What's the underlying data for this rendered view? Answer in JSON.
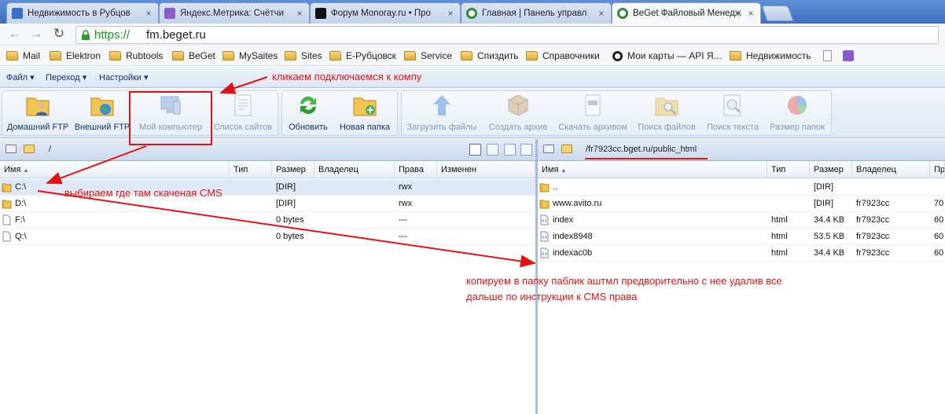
{
  "browser": {
    "tabs": [
      {
        "title": "Недвижимость в Рубцов",
        "icon": "house-favicon",
        "color": "#3b6fc6"
      },
      {
        "title": "Яндекс.Метрика: Счётчи",
        "icon": "metrika-favicon",
        "color": "#8a5cc9"
      },
      {
        "title": "Форум Monoray.ru • Про",
        "icon": "monoray-favicon",
        "color": "#111111"
      },
      {
        "title": "Главная | Панель управл",
        "icon": "beget-favicon",
        "color": "#2e8b2e"
      },
      {
        "title": "BeGet Файловый Менедж",
        "icon": "beget-favicon",
        "color": "#2e8b2e",
        "active": true
      }
    ],
    "url_scheme": "https://",
    "url_host": "fm.beget.ru",
    "bookmarks": [
      "Mail",
      "Elektron",
      "Rubtools",
      "BeGet",
      "MySaites",
      "Sites",
      "Е-Рубцовск",
      "Service",
      "Спиздить",
      "Справочники",
      "Мои карты — API Я...",
      "Недвижимость"
    ]
  },
  "menubar": {
    "file": "Файл",
    "goto": "Переход",
    "settings": "Настройки"
  },
  "ribbon": {
    "home_ftp": "Домашний FTP",
    "external_ftp": "Внешний FTP",
    "my_computer": "Мой компьютер",
    "site_list": "Список сайтов",
    "refresh": "Обновить",
    "new_folder": "Новая папка",
    "upload": "Загрузить файлы",
    "create_archive": "Создать архив",
    "download_archive": "Скачать архивом",
    "file_search": "Поиск файлов",
    "text_search": "Поиск текста",
    "folder_size": "Размер папок"
  },
  "left_pane": {
    "path": "/",
    "columns": [
      "Имя",
      "Тип",
      "Размер",
      "Владелец",
      "Права",
      "Изменен"
    ],
    "rows": [
      {
        "name": "C:\\",
        "type": "",
        "size": "[DIR]",
        "owner": "",
        "perms": "rwx",
        "icon": "folder"
      },
      {
        "name": "D:\\",
        "type": "",
        "size": "[DIR]",
        "owner": "",
        "perms": "rwx",
        "icon": "folder"
      },
      {
        "name": "F:\\",
        "type": "",
        "size": "0 bytes",
        "owner": "",
        "perms": "---",
        "icon": "file"
      },
      {
        "name": "Q:\\",
        "type": "",
        "size": "0 bytes",
        "owner": "",
        "perms": "---",
        "icon": "file"
      }
    ]
  },
  "right_pane": {
    "path": "/fr7923cc.bget.ru/public_html",
    "columns": [
      "Имя",
      "Тип",
      "Размер",
      "Владелец",
      "Пр"
    ],
    "rows": [
      {
        "name": "..",
        "type": "",
        "size": "[DIR]",
        "owner": "",
        "perms": "",
        "icon": "folder"
      },
      {
        "name": "www.avito.ru",
        "type": "",
        "size": "[DIR]",
        "owner": "fr7923cc",
        "perms": "70",
        "icon": "folder"
      },
      {
        "name": "index",
        "type": "html",
        "size": "34.4 KB",
        "owner": "fr7923cc",
        "perms": "60",
        "icon": "html"
      },
      {
        "name": "index8948",
        "type": "html",
        "size": "53.5 KB",
        "owner": "fr7923cc",
        "perms": "60",
        "icon": "html"
      },
      {
        "name": "indexac0b",
        "type": "html",
        "size": "34.4 KB",
        "owner": "fr7923cc",
        "perms": "60",
        "icon": "html"
      }
    ]
  },
  "annotations": {
    "connect": "кликаем подключаемся к компу",
    "choose": "выбираем где там скаченая CMS",
    "copy_line1": "копируем в папку паблик аштмл предворительно с нее удалив все",
    "copy_line2": "дальше по инструкции к CMS права",
    "color": "#e01313"
  }
}
